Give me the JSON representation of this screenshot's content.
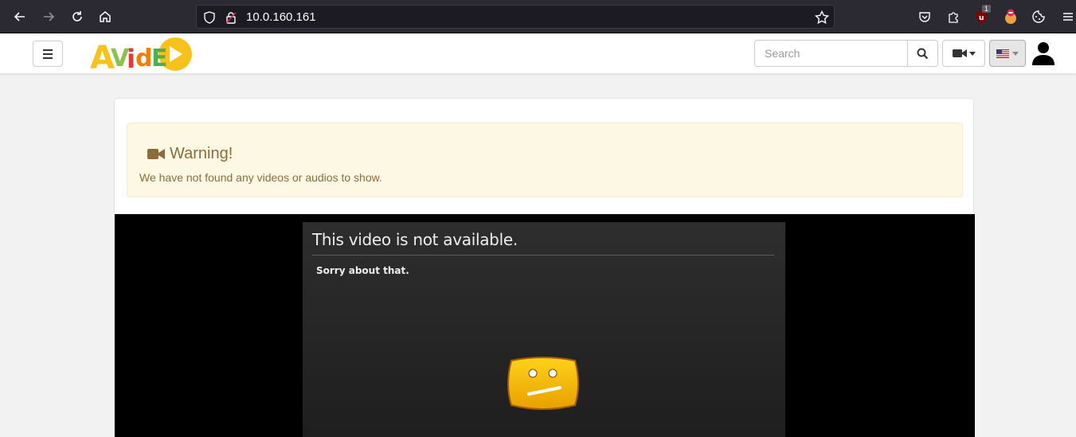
{
  "browser": {
    "url": "10.0.160.161",
    "ublock_count": "1"
  },
  "navbar": {
    "logo_text": "AVideo",
    "search_placeholder": "Search"
  },
  "alert": {
    "title": "Warning!",
    "message": "We have not found any videos or audios to show."
  },
  "player": {
    "error_title": "This video is not  available.",
    "error_subtitle": "Sorry about that."
  },
  "colors": {
    "alert_bg": "#fcf8e3",
    "alert_text": "#8a6d3b",
    "chrome_bg": "#2b2a33",
    "face_yellow": "#f5b800"
  }
}
